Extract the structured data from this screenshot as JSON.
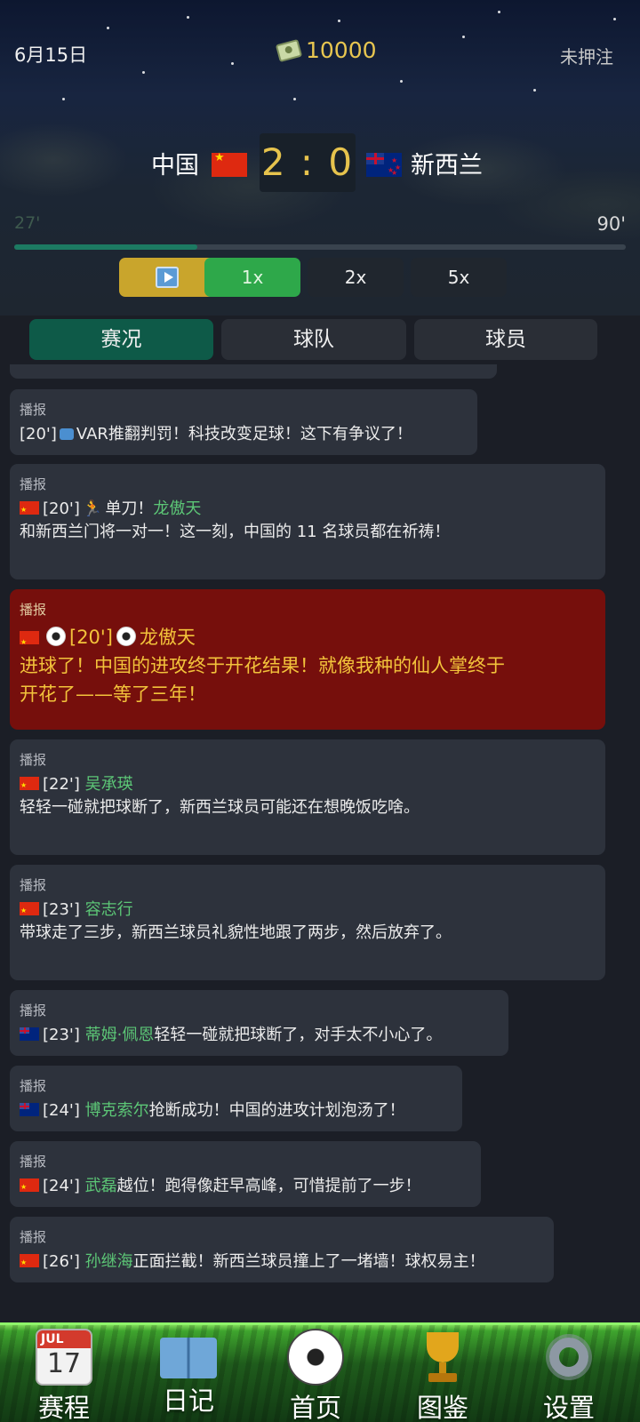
{
  "status": {
    "date": "6月15日",
    "coins": "10000",
    "bet_status": "未押注"
  },
  "match": {
    "home_team": "中国",
    "away_team": "新西兰",
    "score": "2 : 0",
    "current_minute": "27'",
    "end_minute": "90'",
    "progress_fraction": 0.3
  },
  "speed": {
    "options": [
      "1x",
      "2x",
      "5x"
    ],
    "selected": "1x"
  },
  "tabs": {
    "items": [
      "赛况",
      "球队",
      "球员"
    ],
    "active": "赛况"
  },
  "feed": {
    "tag": "播报",
    "messages": [
      {
        "time": "[20']",
        "text": "VAR推翻判罚！科技改变足球！这下有争议了！"
      },
      {
        "time": "[20']",
        "mid": "单刀！",
        "player": "龙傲天",
        "text": "和新西兰门将一对一！这一刻，中国的 11 名球员都在祈祷！"
      },
      {
        "time": "[20']",
        "player": "龙傲天",
        "text1": "进球了！中国的进攻终于开花结果！就像我种的仙人掌终于",
        "text2": "开花了——等了三年！"
      },
      {
        "time": "[22']",
        "player": "吴承瑛",
        "text": "轻轻一碰就把球断了，新西兰球员可能还在想晚饭吃啥。"
      },
      {
        "time": "[23']",
        "player": "容志行",
        "text": "带球走了三步，新西兰球员礼貌性地跟了两步，然后放弃了。"
      },
      {
        "time": "[23']",
        "player": "蒂姆·佩恩",
        "text": "轻轻一碰就把球断了，对手太不小心了。"
      },
      {
        "time": "[24']",
        "player": "博克索尔",
        "text": "抢断成功！中国的进攻计划泡汤了！"
      },
      {
        "time": "[24']",
        "player": "武磊",
        "text": "越位！跑得像赶早高峰，可惜提前了一步！"
      },
      {
        "time": "[26']",
        "player": "孙继海",
        "text": "正面拦截！新西兰球员撞上了一堵墙！球权易主！"
      }
    ]
  },
  "nav": {
    "calendar_month": "JUL",
    "calendar_day": "17",
    "items": [
      "赛程",
      "日记",
      "首页",
      "图鉴",
      "设置"
    ]
  },
  "colors": {
    "gold": "#e6c34d",
    "green_active": "#2ea84a",
    "tab_active": "#0e5a48",
    "goal_bg": "#760f0c",
    "player_name": "#5cc676"
  }
}
